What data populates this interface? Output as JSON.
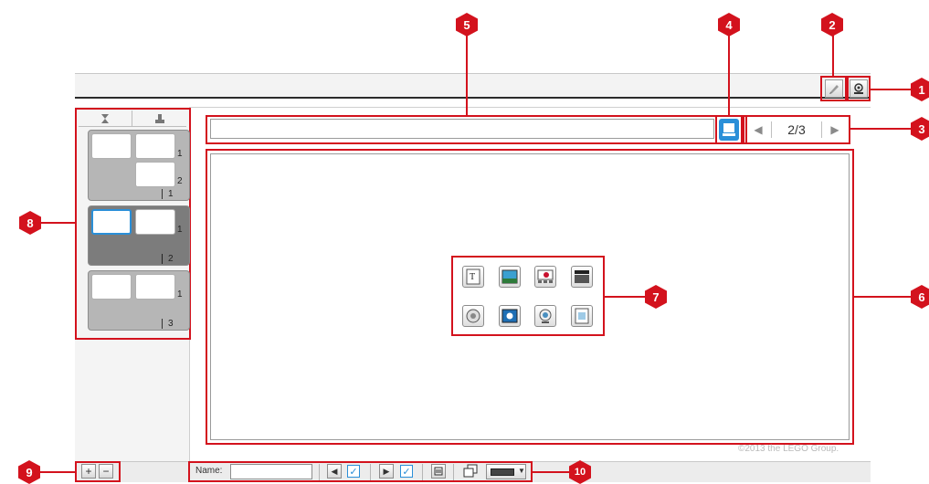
{
  "page_indicator": "2/3",
  "copyright": "©2013 the LEGO Group.",
  "bottom_bar": {
    "name_label": "Name:",
    "name_value": ""
  },
  "pages": [
    {
      "number": "1",
      "subpages": [
        "1",
        "2"
      ]
    },
    {
      "number": "2",
      "subpages": [
        "1"
      ]
    },
    {
      "number": "3",
      "subpages": [
        "1"
      ]
    }
  ],
  "callouts": [
    "1",
    "2",
    "3",
    "4",
    "5",
    "6",
    "7",
    "8",
    "9",
    "10"
  ],
  "content_icons": [
    "text-icon",
    "image-icon",
    "image-sequence-icon",
    "video-icon",
    "sound-icon",
    "video-player-icon",
    "camera-icon",
    "data-icon"
  ],
  "colors": {
    "highlight": "#d3121d",
    "selected": "#2a8fd8",
    "window_bar": "#f3f3f3"
  }
}
